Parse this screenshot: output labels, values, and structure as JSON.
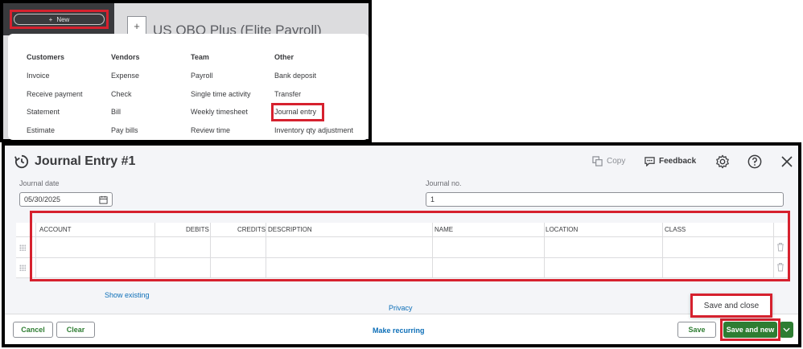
{
  "top": {
    "new_button_label": "New",
    "company_title": "US QBO Plus (Elite Payroll)",
    "menu": {
      "columns": [
        {
          "header": "Customers",
          "items": [
            "Invoice",
            "Receive payment",
            "Statement",
            "Estimate"
          ]
        },
        {
          "header": "Vendors",
          "items": [
            "Expense",
            "Check",
            "Bill",
            "Pay bills"
          ]
        },
        {
          "header": "Team",
          "items": [
            "Payroll",
            "Single time activity",
            "Weekly timesheet",
            "Review time"
          ]
        },
        {
          "header": "Other",
          "items": [
            "Bank deposit",
            "Transfer",
            "Journal entry",
            "Inventory qty adjustment"
          ]
        }
      ]
    }
  },
  "journal": {
    "title": "Journal Entry #1",
    "copy_label": "Copy",
    "feedback_label": "Feedback",
    "journal_date_label": "Journal date",
    "journal_date_value": "05/30/2025",
    "journal_no_label": "Journal no.",
    "journal_no_value": "1",
    "columns": [
      "ACCOUNT",
      "DEBITS",
      "CREDITS",
      "DESCRIPTION",
      "NAME",
      "LOCATION",
      "CLASS"
    ],
    "show_existing": "Show existing",
    "privacy": "Privacy"
  },
  "footer": {
    "cancel": "Cancel",
    "clear": "Clear",
    "make_recurring": "Make recurring",
    "save": "Save",
    "save_and_new": "Save and new",
    "save_and_close": "Save and close"
  },
  "colors": {
    "highlight": "#d6212e",
    "primary_green": "#2e7d32",
    "link_blue": "#0d6fb8"
  }
}
